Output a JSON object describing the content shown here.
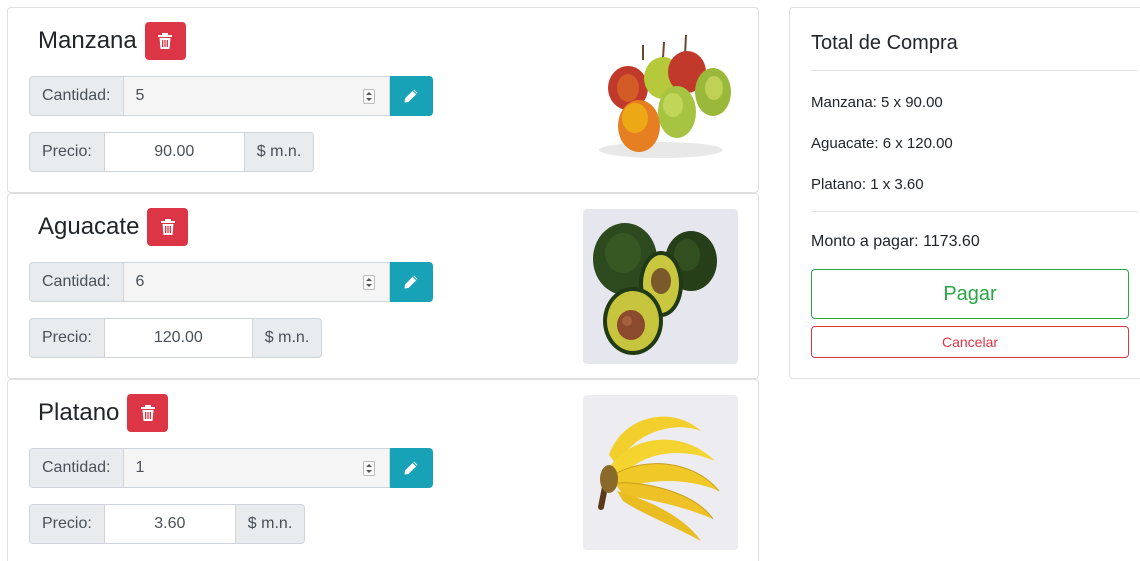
{
  "products": [
    {
      "name": "Manzana",
      "quantity_label": "Cantidad:",
      "quantity": "5",
      "price_label": "Precio:",
      "price": "90.00",
      "currency": "$ m.n.",
      "image": "apples-photo",
      "delete_icon": "trash-icon",
      "edit_icon": "pencil-icon"
    },
    {
      "name": "Aguacate",
      "quantity_label": "Cantidad:",
      "quantity": "6",
      "price_label": "Precio:",
      "price": "120.00",
      "currency": "$ m.n.",
      "image": "avocados-photo",
      "delete_icon": "trash-icon",
      "edit_icon": "pencil-icon"
    },
    {
      "name": "Platano",
      "quantity_label": "Cantidad:",
      "quantity": "1",
      "price_label": "Precio:",
      "price": "3.60",
      "currency": "$ m.n.",
      "image": "bananas-photo",
      "delete_icon": "trash-icon",
      "edit_icon": "pencil-icon"
    }
  ],
  "summary": {
    "title": "Total de Compra",
    "lines": [
      "Manzana: 5 x 90.00",
      "Aguacate: 6 x 120.00",
      "Platano: 1 x 3.60"
    ],
    "total": "Monto a pagar: 1173.60",
    "pay_label": "Pagar",
    "cancel_label": "Cancelar"
  },
  "colors": {
    "danger": "#dc3545",
    "info": "#17a2b8",
    "success": "#28a745",
    "addon_bg": "#e9ecef"
  }
}
